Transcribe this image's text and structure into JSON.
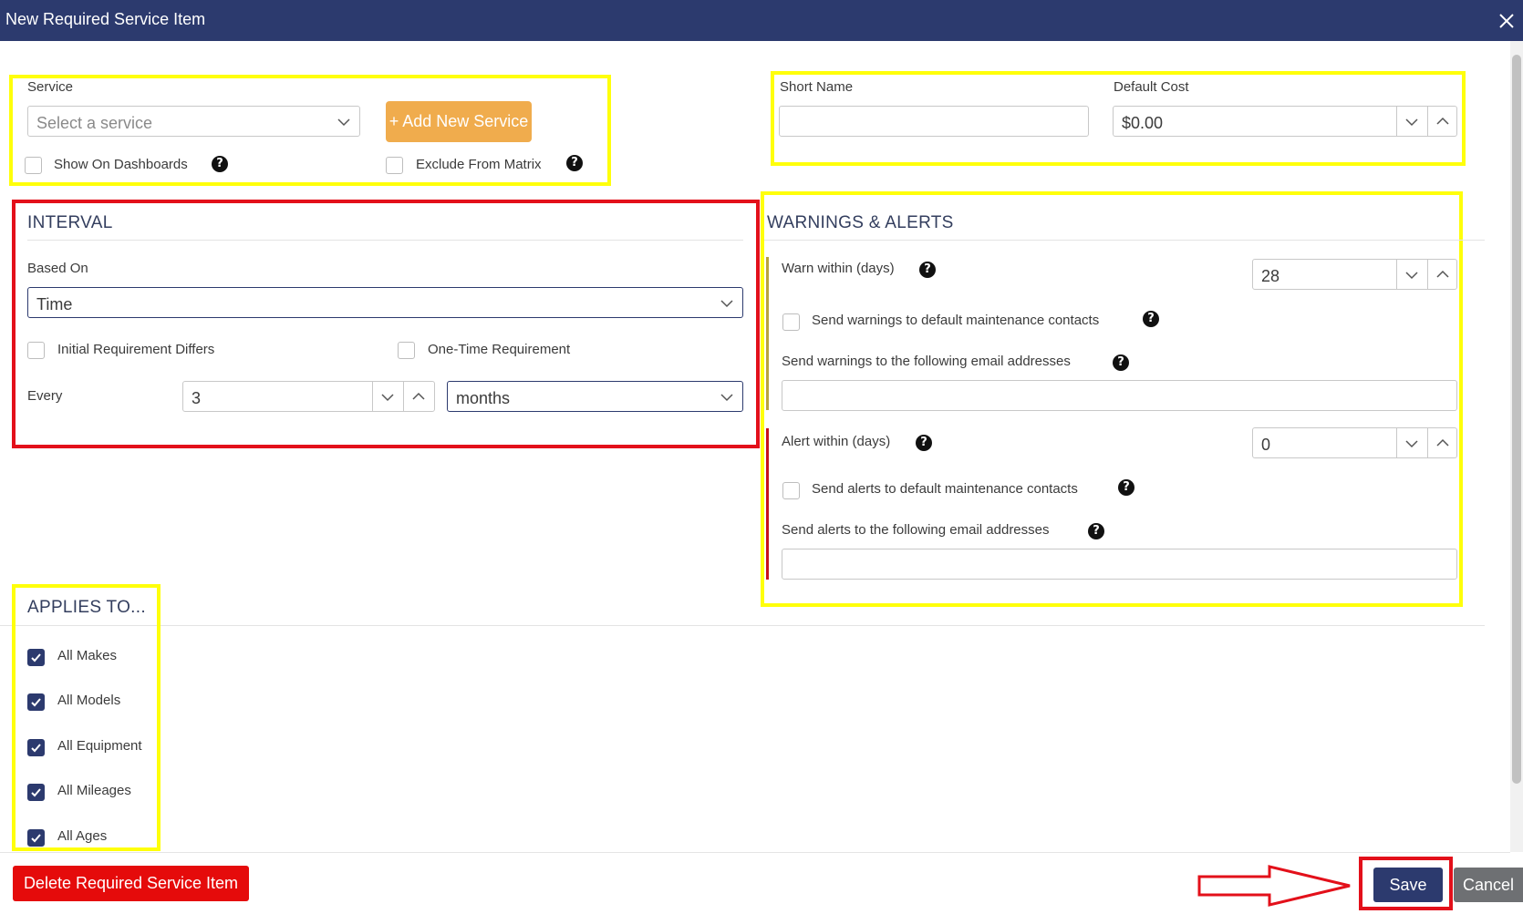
{
  "dialog": {
    "title": "New Required Service Item"
  },
  "service": {
    "label": "Service",
    "placeholder": "Select a service",
    "add_button": "+ Add New Service",
    "show_on_dashboards": "Show On Dashboards",
    "exclude_from_matrix": "Exclude From Matrix"
  },
  "short_name": {
    "label": "Short Name",
    "value": ""
  },
  "default_cost": {
    "label": "Default Cost",
    "value": "$0.00"
  },
  "interval": {
    "title": "INTERVAL",
    "based_on_label": "Based On",
    "based_on_value": "Time",
    "initial_requirement_differs": "Initial Requirement Differs",
    "one_time_requirement": "One-Time Requirement",
    "every_label": "Every",
    "every_value": "3",
    "unit_value": "months"
  },
  "warnings": {
    "title": "WARNINGS & ALERTS",
    "warn_within_label": "Warn within (days)",
    "warn_within_value": "28",
    "send_warnings_default": "Send warnings to default maintenance contacts",
    "send_warnings_emails_label": "Send warnings to the following email addresses",
    "warn_emails_value": "",
    "alert_within_label": "Alert within (days)",
    "alert_within_value": "0",
    "send_alerts_default": "Send alerts to default maintenance contacts",
    "send_alerts_emails_label": "Send alerts to the following email addresses",
    "alert_emails_value": ""
  },
  "applies_to": {
    "title": "APPLIES TO...",
    "items": [
      {
        "label": "All Makes",
        "checked": true
      },
      {
        "label": "All Models",
        "checked": true
      },
      {
        "label": "All Equipment",
        "checked": true
      },
      {
        "label": "All Mileages",
        "checked": true
      },
      {
        "label": "All Ages",
        "checked": true
      }
    ]
  },
  "footer": {
    "delete_button": "Delete Required Service Item",
    "save_button": "Save",
    "cancel_button": "Cancel"
  },
  "icons": {
    "close": "close-icon",
    "chevron_down": "chevron-down-icon",
    "chevron_up": "chevron-up-icon",
    "help": "help-icon",
    "check": "check-icon",
    "arrow": "arrow-right-icon"
  },
  "colors": {
    "header": "#2c3a6e",
    "add_button": "#f0ac4d",
    "delete_button": "#e50b0b",
    "save_button": "#2c3a6e",
    "cancel_button": "#6e7073",
    "annotation_yellow": "#ffff0a",
    "annotation_red": "#e3101a"
  }
}
